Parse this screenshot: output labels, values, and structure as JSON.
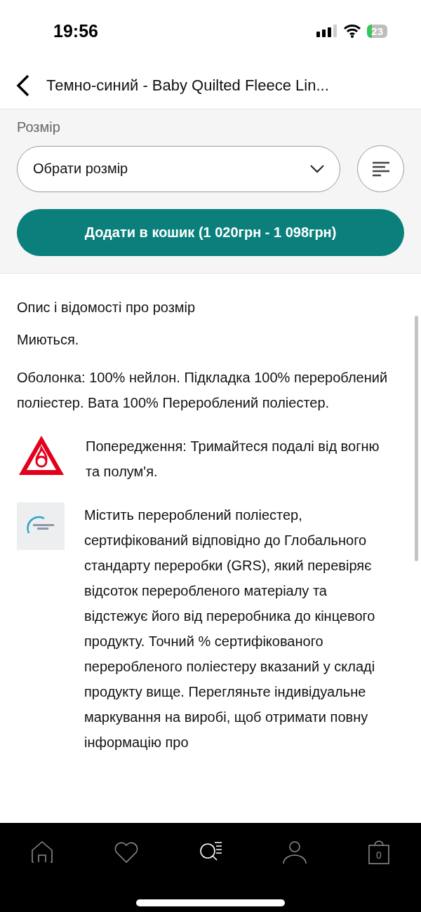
{
  "status_bar": {
    "time": "19:56",
    "battery": "23"
  },
  "header": {
    "title": "Темно-синий - Baby Quilted Fleece Lin..."
  },
  "size": {
    "label": "Розмір",
    "select_placeholder": "Обрати розмір"
  },
  "add_to_cart": {
    "label": "Додати в кошик (1 020грн - 1 098грн)"
  },
  "description": {
    "heading": "Опис і відомості про розмір",
    "paragraphs": [
      "Миються.",
      "Оболонка: 100% нейлон. Підкладка 100% перероблений поліестер. Вата 100% Перероблений поліестер."
    ],
    "notices": [
      {
        "kind": "fire-warning",
        "text": "Попередження: Тримайтеся подалі від вогню та полум'я."
      },
      {
        "kind": "recycled-logo",
        "text": "Містить перероблений поліестер, сертифікований відповідно до Глобального стандарту переробки (GRS), який перевіряє відсоток переробленого матеріалу та відстежує його від переробника до кінцевого продукту. Точний % сертифікованого переробленого поліестеру вказаний у складі продукту вище. Перегляньте індивідуальне маркування на виробі, щоб отримати повну інформацію про"
      }
    ]
  },
  "tab_bar": [
    {
      "kind": "home",
      "selected": false
    },
    {
      "kind": "wishlist",
      "selected": false
    },
    {
      "kind": "search",
      "selected": true
    },
    {
      "kind": "account",
      "selected": false
    },
    {
      "kind": "bag",
      "selected": false,
      "count": "0"
    }
  ]
}
